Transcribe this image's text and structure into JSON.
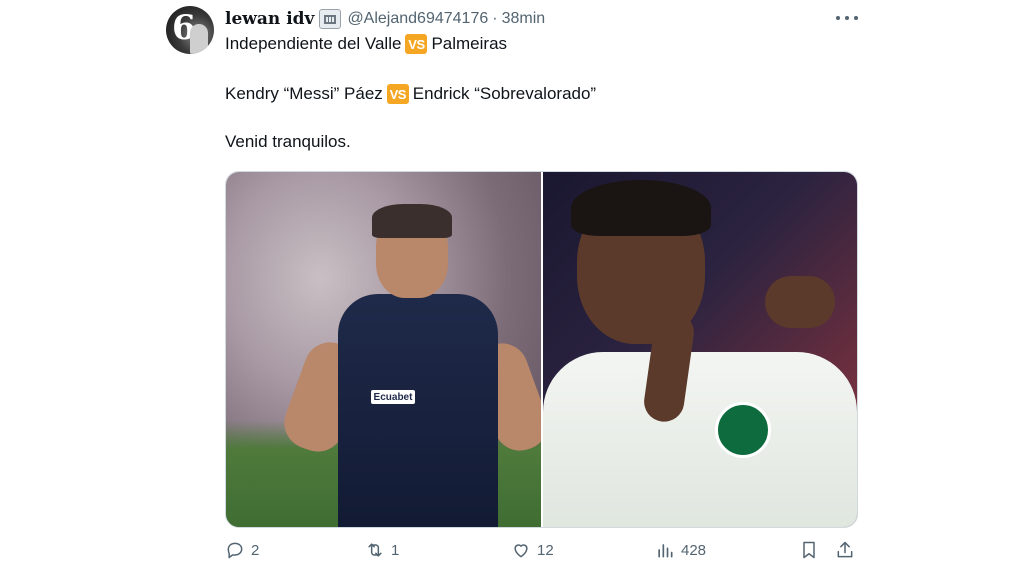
{
  "tweet": {
    "author_name": "lewan idv",
    "author_handle": "@Alejand69474176",
    "separator": "·",
    "time": "38min",
    "line1": {
      "left": "Independiente del Valle",
      "vs": "VS",
      "right": "Palmeiras"
    },
    "line2": {
      "left": "Kendry “Messi” Páez",
      "vs": "VS",
      "right": "Endrick “Sobrevalorado”"
    },
    "line3": "Venid tranquilos.",
    "media_left_sponsor": "Ecuabet"
  },
  "actions": {
    "replies": "2",
    "reposts": "1",
    "likes": "12",
    "views": "428"
  },
  "icons": [
    "more-icon",
    "reply-icon",
    "repost-icon",
    "like-icon",
    "views-icon",
    "bookmark-icon",
    "share-icon",
    "badge-icon"
  ],
  "colors": {
    "secondary": "#536471",
    "vs_badge": "#f5a623"
  }
}
